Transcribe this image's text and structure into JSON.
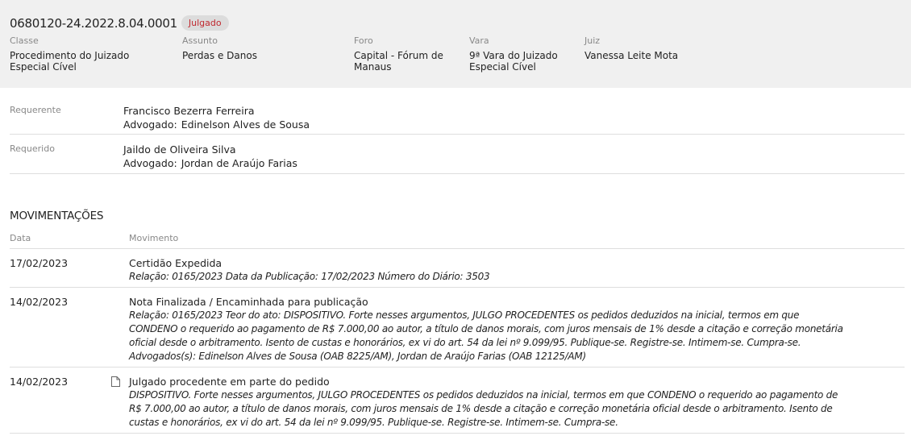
{
  "process": {
    "number": "0680120-24.2022.8.04.0001",
    "status": "Julgado",
    "status_color": "#c0282e"
  },
  "meta": [
    {
      "label": "Classe",
      "value_line1": "Procedimento do Juizado",
      "value_line2": "Especial Cível"
    },
    {
      "label": "Assunto",
      "value_line1": "Perdas e Danos",
      "value_line2": ""
    },
    {
      "label": "Foro",
      "value_line1": "Capital - Fórum de",
      "value_line2": "Manaus"
    },
    {
      "label": "Vara",
      "value_line1": "9ª Vara do Juizado",
      "value_line2": "Especial Cível"
    },
    {
      "label": "Juiz",
      "value_line1": "Vanessa Leite Mota",
      "value_line2": ""
    }
  ],
  "parties": [
    {
      "role": "Requerente",
      "name": "Francisco Bezerra Ferreira",
      "lawyer_label": "Advogado:",
      "lawyer": "Edinelson Alves de Sousa"
    },
    {
      "role": "Requerido",
      "name": "Jaildo de Oliveira Silva",
      "lawyer_label": "Advogado:",
      "lawyer": "Jordan de Araújo Farias"
    }
  ],
  "movements": {
    "title": "MOVIMENTAÇÕES",
    "col_date": "Data",
    "col_movement": "Movimento",
    "items": [
      {
        "date": "17/02/2023",
        "title": "Certidão Expedida",
        "desc": [
          "Relação: 0165/2023 Data da Publicação: 17/02/2023 Número do Diário: 3503"
        ],
        "icon": ""
      },
      {
        "date": "14/02/2023",
        "title": "Nota Finalizada / Encaminhada para publicação",
        "desc": [
          "Relação: 0165/2023 Teor do ato: DISPOSITIVO. Forte nesses argumentos, JULGO PROCEDENTES os pedidos deduzidos na inicial, termos em que",
          "CONDENO o requerido ao pagamento de R$ 7.000,00 ao autor, a título de danos morais, com juros mensais de 1% desde a citação e correção monetária",
          "oficial desde o arbitramento. Isento de custas e honorários, ex vi do art. 54 da lei nº 9.099/95. Publique-se. Registre-se. Intimem-se. Cumpra-se.",
          "Advogados(s): Edinelson Alves de Sousa (OAB 8225/AM), Jordan de Araújo Farias (OAB 12125/AM)"
        ],
        "icon": ""
      },
      {
        "date": "14/02/2023",
        "title": "Julgado procedente em parte do pedido",
        "desc": [
          "DISPOSITIVO. Forte nesses argumentos, JULGO PROCEDENTES os pedidos deduzidos na inicial, termos em que CONDENO o requerido ao pagamento de",
          "R$ 7.000,00 ao autor, a título de danos morais, com juros mensais de 1% desde a citação e correção monetária oficial desde o arbitramento. Isento de",
          "custas e honorários, ex vi do art. 54 da lei nº 9.099/95. Publique-se. Registre-se. Intimem-se. Cumpra-se."
        ],
        "icon": "document-icon"
      }
    ]
  }
}
